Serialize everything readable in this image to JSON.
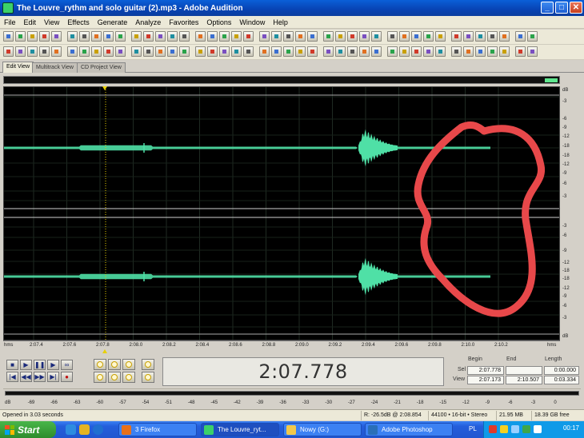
{
  "window": {
    "title": "The Louvre_rythm and solo guitar (2).mp3 - Adobe Audition",
    "buttons": {
      "minimize": "_",
      "maximize": "□",
      "close": "✕"
    }
  },
  "menu": [
    "File",
    "Edit",
    "View",
    "Effects",
    "Generate",
    "Analyze",
    "Favorites",
    "Options",
    "Window",
    "Help"
  ],
  "tabs": [
    "Edit View",
    "Multitrack View",
    "CD Project View"
  ],
  "waveform": {
    "db_labels_ch1": [
      "dB",
      "-3",
      "-6",
      "-9",
      "-12",
      "-18",
      "-18",
      "-12",
      "-9",
      "-6",
      "-3"
    ],
    "db_labels_ch2": [
      "-3",
      "-6",
      "-9",
      "-12",
      "-18",
      "-18",
      "-12",
      "-9",
      "-6",
      "-3",
      "dB"
    ],
    "annotation_color": "#e8484a",
    "waveform_color": "#4fe0a6"
  },
  "ruler": {
    "unit_left": "hms",
    "unit_right": "hms",
    "ticks": [
      "2:07.4",
      "2:07.6",
      "2:07.8",
      "2:08.0",
      "2:08.2",
      "2:08.4",
      "2:08.6",
      "2:08.8",
      "2:09.0",
      "2:09.2",
      "2:09.4",
      "2:09.6",
      "2:09.8",
      "2:10.0",
      "2:10.2"
    ]
  },
  "transport": {
    "row1": [
      "■",
      "▶",
      "❚❚",
      "▶",
      "∞"
    ],
    "row2": [
      "|◀",
      "◀◀",
      "▶▶",
      "▶|",
      "●"
    ]
  },
  "time_display": "2:07.778",
  "selection": {
    "headers": [
      "Begin",
      "End",
      "Length"
    ],
    "rows": [
      {
        "label": "Sel",
        "values": [
          "2:07.778",
          "",
          "0:00.000"
        ]
      },
      {
        "label": "View",
        "values": [
          "2:07.173",
          "2:10.507",
          "0:03.334"
        ]
      }
    ]
  },
  "meter": {
    "labels": [
      "dB",
      "-69",
      "-66",
      "-63",
      "-60",
      "-57",
      "-54",
      "-51",
      "-48",
      "-45",
      "-42",
      "-39",
      "-36",
      "-33",
      "-30",
      "-27",
      "-24",
      "-21",
      "-18",
      "-15",
      "-12",
      "-9",
      "-6",
      "-3",
      "0"
    ]
  },
  "status": {
    "left": "Opened in 3.03 seconds",
    "cursor": "R: -26.5dB @  2:08.854",
    "format": "44100 • 16-bit • Stereo",
    "size": "21.95 MB",
    "free": "18.39 GB free"
  },
  "taskbar": {
    "start": "Start",
    "tasks": [
      {
        "label": "3 Firefox",
        "color": "#e8701a"
      },
      {
        "label": "The Louvre_ryt...",
        "color": "#3bd06a"
      },
      {
        "label": "Nowy (G:)",
        "color": "#f2c84b"
      },
      {
        "label": "Adobe Photoshop",
        "color": "#2a6fb8"
      }
    ],
    "language": "PL",
    "clock": "00:17"
  }
}
